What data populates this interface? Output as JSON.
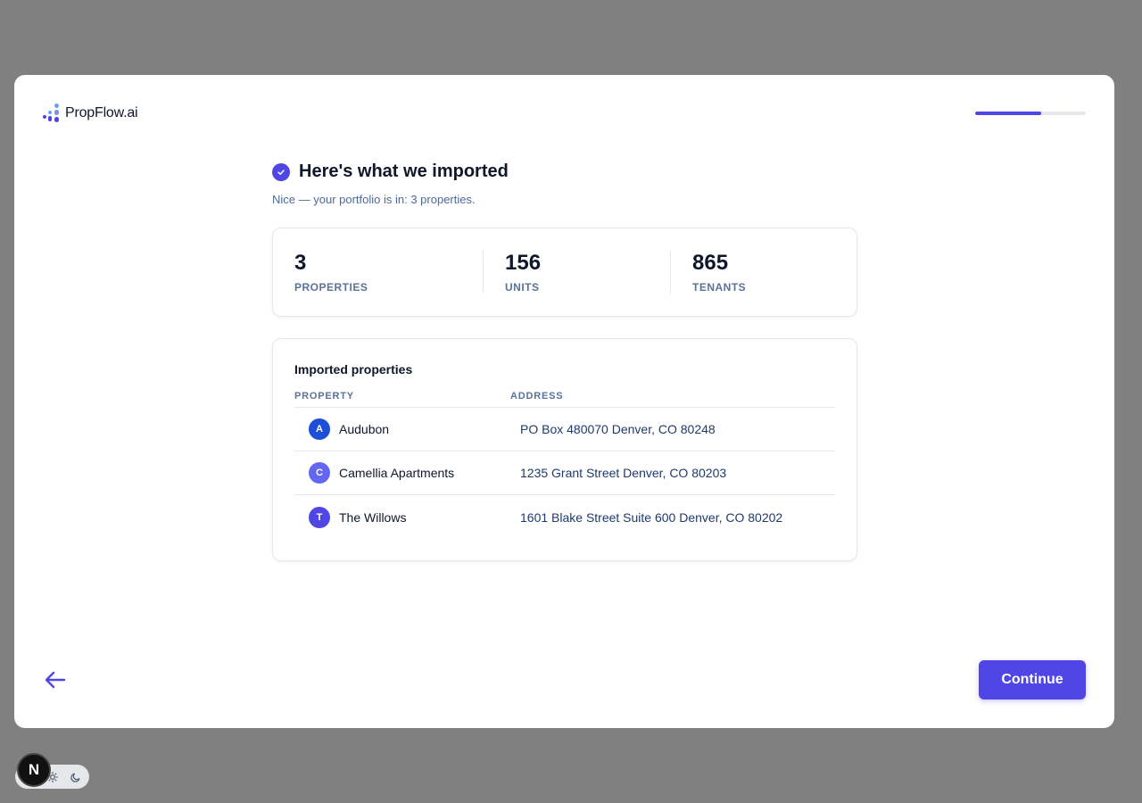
{
  "brand": {
    "name": "PropFlow.ai"
  },
  "progress": {
    "fraction": 0.6,
    "color": "#4f46e5"
  },
  "header": {
    "title": "Here's what we imported",
    "subtitle": "Nice — your portfolio is in: 3 properties."
  },
  "stats": [
    {
      "value": "3",
      "label": "PROPERTIES"
    },
    {
      "value": "156",
      "label": "UNITS"
    },
    {
      "value": "865",
      "label": "TENANTS"
    }
  ],
  "table": {
    "title": "Imported properties",
    "columns": [
      "PROPERTY",
      "ADDRESS"
    ],
    "rows": [
      {
        "initial": "A",
        "name": "Audubon",
        "address": "PO Box 480070 Denver, CO 80248",
        "avatar_color": "#1d4ed8"
      },
      {
        "initial": "C",
        "name": "Camellia Apartments",
        "address": "1235 Grant Street Denver, CO 80203",
        "avatar_color": "#6366f1"
      },
      {
        "initial": "T",
        "name": "The Willows",
        "address": "1601 Blake Street Suite 600 Denver, CO 80202",
        "avatar_color": "#4f46e5"
      }
    ]
  },
  "footer": {
    "continue_label": "Continue"
  },
  "dev_badge": {
    "letter": "N"
  },
  "icons": {
    "check": "check-icon",
    "back": "arrow-left-icon",
    "theme_light": "sun-icon",
    "theme_dark": "moon-icon"
  },
  "colors": {
    "accent": "#4f46e5",
    "muted_text": "#5b7299"
  }
}
